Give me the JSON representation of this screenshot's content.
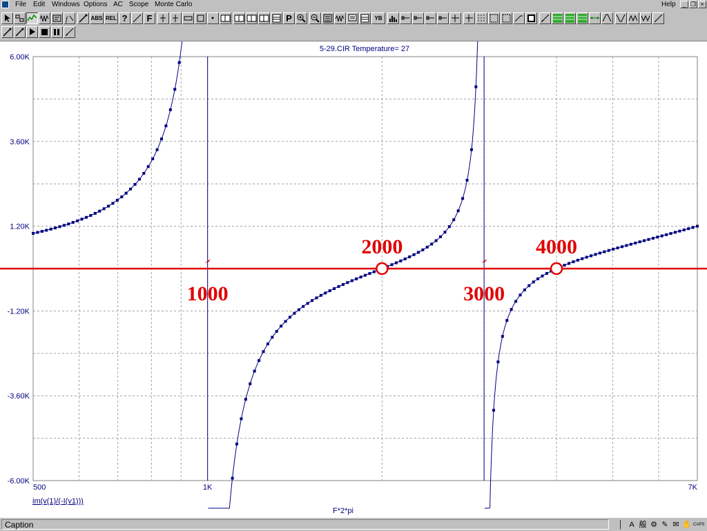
{
  "menu": {
    "items": [
      "File",
      "Edit",
      "Windows",
      "Options",
      "AC",
      "Scope",
      "Monte Carlo"
    ],
    "help": "Help"
  },
  "window_controls": {
    "minimize": "_",
    "restore": "❐",
    "close": "×"
  },
  "toolbar": {
    "row1": [
      {
        "name": "select-tool-button",
        "icon": "arrow-icon"
      },
      {
        "name": "component-tool-button",
        "icon": "component-icon"
      },
      {
        "name": "plot-mode-button",
        "icon": "plot-icon",
        "pressed": true
      },
      {
        "name": "wave-mode-button",
        "icon": "wave-icon"
      },
      {
        "name": "plot-properties-button",
        "icon": "properties-icon"
      },
      {
        "name": "function-button",
        "icon": "function-icon"
      },
      {
        "name": "probe-button",
        "icon": "probe-icon"
      },
      {
        "name": "abs-button",
        "glyph": "ABS"
      },
      {
        "name": "rel-button",
        "glyph": "REL"
      },
      {
        "name": "help-query-button",
        "glyph": "?"
      },
      {
        "name": "slope-button",
        "icon": "slope-icon"
      },
      {
        "name": "font-button",
        "glyph": "F"
      },
      {
        "name": "cursor-left-button",
        "icon": "cursor-icon"
      },
      {
        "name": "cursor-right-button",
        "icon": "cursor-icon"
      },
      {
        "name": "tag-button",
        "icon": "tag-icon"
      },
      {
        "name": "box-button",
        "icon": "box-icon"
      },
      {
        "name": "point-button",
        "icon": "point-icon"
      },
      {
        "name": "layout-1-button",
        "icon": "layout-icon"
      },
      {
        "name": "layout-2-button",
        "icon": "layout-icon"
      },
      {
        "name": "layout-3-button",
        "icon": "layout-icon"
      },
      {
        "name": "layout-4-button",
        "icon": "layout-icon"
      },
      {
        "name": "numeric-output-button",
        "icon": "table-icon"
      },
      {
        "name": "print-button",
        "glyph": "P"
      },
      {
        "name": "zoom-in-button",
        "icon": "zoom-in-icon"
      },
      {
        "name": "zoom-out-button",
        "icon": "zoom-out-icon"
      },
      {
        "name": "auto-scale-button",
        "icon": "scale-icon"
      },
      {
        "name": "waveform-button",
        "icon": "wave-icon"
      },
      {
        "name": "screen-button",
        "icon": "screen-icon"
      },
      {
        "name": "grid-table-button",
        "icon": "table-icon"
      },
      {
        "name": "y-scale-button",
        "glyph": "YB"
      },
      {
        "name": "histogram-button",
        "icon": "histogram-icon"
      },
      {
        "name": "token-1-button",
        "icon": "line-icon"
      },
      {
        "name": "token-2-button",
        "icon": "line-icon"
      },
      {
        "name": "token-3-button",
        "icon": "line-icon"
      },
      {
        "name": "token-4-button",
        "icon": "line-icon"
      },
      {
        "name": "cross-1-button",
        "icon": "cross-icon"
      },
      {
        "name": "cross-2-button",
        "icon": "cross-icon"
      },
      {
        "name": "grid-dots-button",
        "icon": "dots-icon"
      },
      {
        "name": "frame-button",
        "icon": "frame-icon"
      },
      {
        "name": "frame-2-button",
        "icon": "frame-icon"
      },
      {
        "name": "ramp-button",
        "icon": "ramp-icon"
      },
      {
        "name": "square-button",
        "icon": "square-icon"
      },
      {
        "name": "diagonal-button",
        "icon": "diag-icon"
      },
      {
        "name": "green-grid-1-button",
        "icon": "green-grid-icon"
      },
      {
        "name": "green-grid-2-button",
        "icon": "green-grid-icon"
      },
      {
        "name": "green-grid-3-button",
        "icon": "green-grid-icon"
      },
      {
        "name": "next-point-button",
        "icon": "arrows-icon"
      },
      {
        "name": "peak-button",
        "icon": "peak-icon"
      },
      {
        "name": "valley-button",
        "icon": "valley-icon"
      },
      {
        "name": "high-button",
        "icon": "high-icon"
      },
      {
        "name": "low-button",
        "icon": "low-icon"
      },
      {
        "name": "slope-2-button",
        "icon": "slope-icon"
      }
    ],
    "row2": [
      {
        "name": "scope-probe-button",
        "icon": "probe-icon"
      },
      {
        "name": "scope-probe-2-button",
        "icon": "probe-icon"
      },
      {
        "name": "run-button",
        "icon": "play-icon"
      },
      {
        "name": "stop-button",
        "icon": "stop-icon"
      },
      {
        "name": "pause-button",
        "icon": "pause-icon"
      },
      {
        "name": "step-button",
        "icon": "diag-icon"
      }
    ]
  },
  "chart_data": {
    "type": "line",
    "title": "5-29.CIR Temperature= 27",
    "xlabel": "F*2*pi",
    "ylabel": "im(v(1)/(-I(v1)))",
    "x_scale": "log",
    "xlim": [
      500,
      7000
    ],
    "ylim": [
      -6000,
      6000
    ],
    "x_tick_labels": [
      {
        "value": 500,
        "label": "500"
      },
      {
        "value": 1000,
        "label": "1K"
      },
      {
        "value": 7000,
        "label": "7K"
      }
    ],
    "x_grid": [
      600,
      700,
      800,
      900,
      1000,
      2000,
      3000,
      4000,
      5000,
      6000
    ],
    "y_tick_labels": [
      {
        "value": 6000,
        "label": "6.00K"
      },
      {
        "value": 3600,
        "label": "3.60K"
      },
      {
        "value": 1200,
        "label": "1.20K"
      },
      {
        "value": -1200,
        "label": "-1.20K"
      },
      {
        "value": -3600,
        "label": "-3.60K"
      },
      {
        "value": -6000,
        "label": "-6.00K"
      }
    ],
    "y_grid": [
      4800,
      2400,
      0,
      -2400,
      -4800
    ],
    "grid": true,
    "series": [
      {
        "color": "#000080",
        "model": "foster",
        "zeros": [
          2000,
          4000
        ],
        "poles": [
          1000,
          3000
        ],
        "scale": 525,
        "markers": true
      }
    ],
    "annotations": {
      "zero_line": {
        "y": 0,
        "color": "#e00000"
      },
      "zeros": [
        {
          "x": 2000,
          "label": "2000"
        },
        {
          "x": 4000,
          "label": "4000"
        }
      ],
      "poles": [
        {
          "x": 1000,
          "label": "1000"
        },
        {
          "x": 3000,
          "label": "3000"
        }
      ],
      "color": "#e00000"
    }
  },
  "statusbar": {
    "caption": "Caption",
    "tray": [
      "│",
      "A",
      "般",
      "⚙",
      "✎",
      "✉",
      "✋",
      "CAPS"
    ]
  }
}
